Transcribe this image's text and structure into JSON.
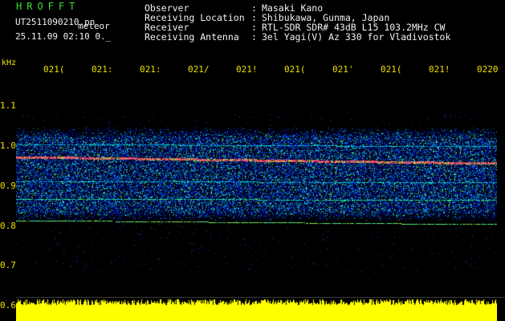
{
  "header": {
    "brand": "HROFFT",
    "filename": "UT2511090210.pn",
    "filename_suffix": "meteor",
    "datetime": "25.11.09 02:10    0._"
  },
  "metadata": [
    {
      "label": "Observer",
      "value": "Masaki Kano"
    },
    {
      "label": "Receiving Location",
      "value": "Shibukawa, Gunma, Japan"
    },
    {
      "label": "Receiver",
      "value": "RTL-SDR SDR# 43dB L15 103.2MHz CW"
    },
    {
      "label": "Receiving Antenna",
      "value": "3el Yagi(V) Az 330 for Vladivostok"
    }
  ],
  "axis": {
    "y_unit": "kHz",
    "y_ticks": [
      "1.1",
      "1.0",
      "0.9",
      "0.8",
      "0.7",
      "0.6"
    ],
    "x_ticks": [
      "021(",
      "021:",
      "021:",
      "021/",
      "021!",
      "021(",
      "021'",
      "021(",
      "021!",
      "0220"
    ]
  },
  "colors": {
    "background": "#000000",
    "brand_text": "#35e035",
    "info_text": "#f2f2f2",
    "axis_text": "#f0e000",
    "echo_line": "#ff2a70",
    "noise_floor": "#ffff00"
  }
}
